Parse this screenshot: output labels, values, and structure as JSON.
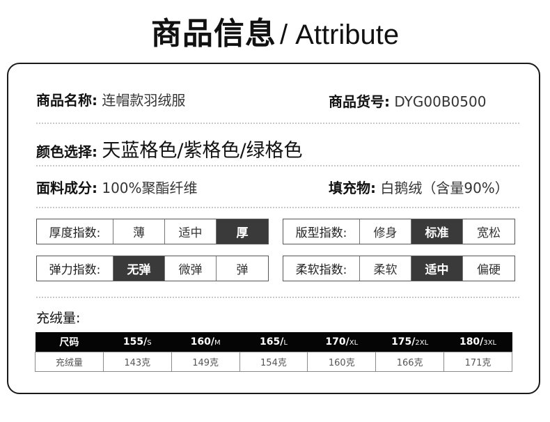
{
  "header": {
    "title_cn": "商品信息",
    "title_en": "/ Attribute"
  },
  "info": {
    "name_label": "商品名称:",
    "name_value": "连帽款羽绒服",
    "sku_label": "商品货号:",
    "sku_value": "DYG00B0500",
    "color_label": "颜色选择:",
    "color_value": "天蓝格色/紫格色/绿格色",
    "fabric_label": "面料成分:",
    "fabric_value": "100%聚酯纤维",
    "fill_label": "填充物:",
    "fill_value": "白鹅绒（含量90%）"
  },
  "indices": [
    {
      "label": "厚度指数:",
      "options": [
        "薄",
        "适中",
        "厚"
      ],
      "selected": 2
    },
    {
      "label": "版型指数:",
      "options": [
        "修身",
        "标准",
        "宽松"
      ],
      "selected": 1
    },
    {
      "label": "弹力指数:",
      "options": [
        "无弹",
        "微弹",
        "弹"
      ],
      "selected": 0
    },
    {
      "label": "柔软指数:",
      "options": [
        "柔软",
        "适中",
        "偏硬"
      ],
      "selected": 1
    }
  ],
  "size_table": {
    "title": "充绒量:",
    "header_label": "尺码",
    "row_label": "充绒量",
    "sizes": [
      {
        "num": "155/",
        "code": "S",
        "fill": "143克"
      },
      {
        "num": "160/",
        "code": "M",
        "fill": "149克"
      },
      {
        "num": "165/",
        "code": "L",
        "fill": "154克"
      },
      {
        "num": "170/",
        "code": "XL",
        "fill": "160克"
      },
      {
        "num": "175/",
        "code": "2XL",
        "fill": "166克"
      },
      {
        "num": "180/",
        "code": "3XL",
        "fill": "171克"
      }
    ]
  }
}
